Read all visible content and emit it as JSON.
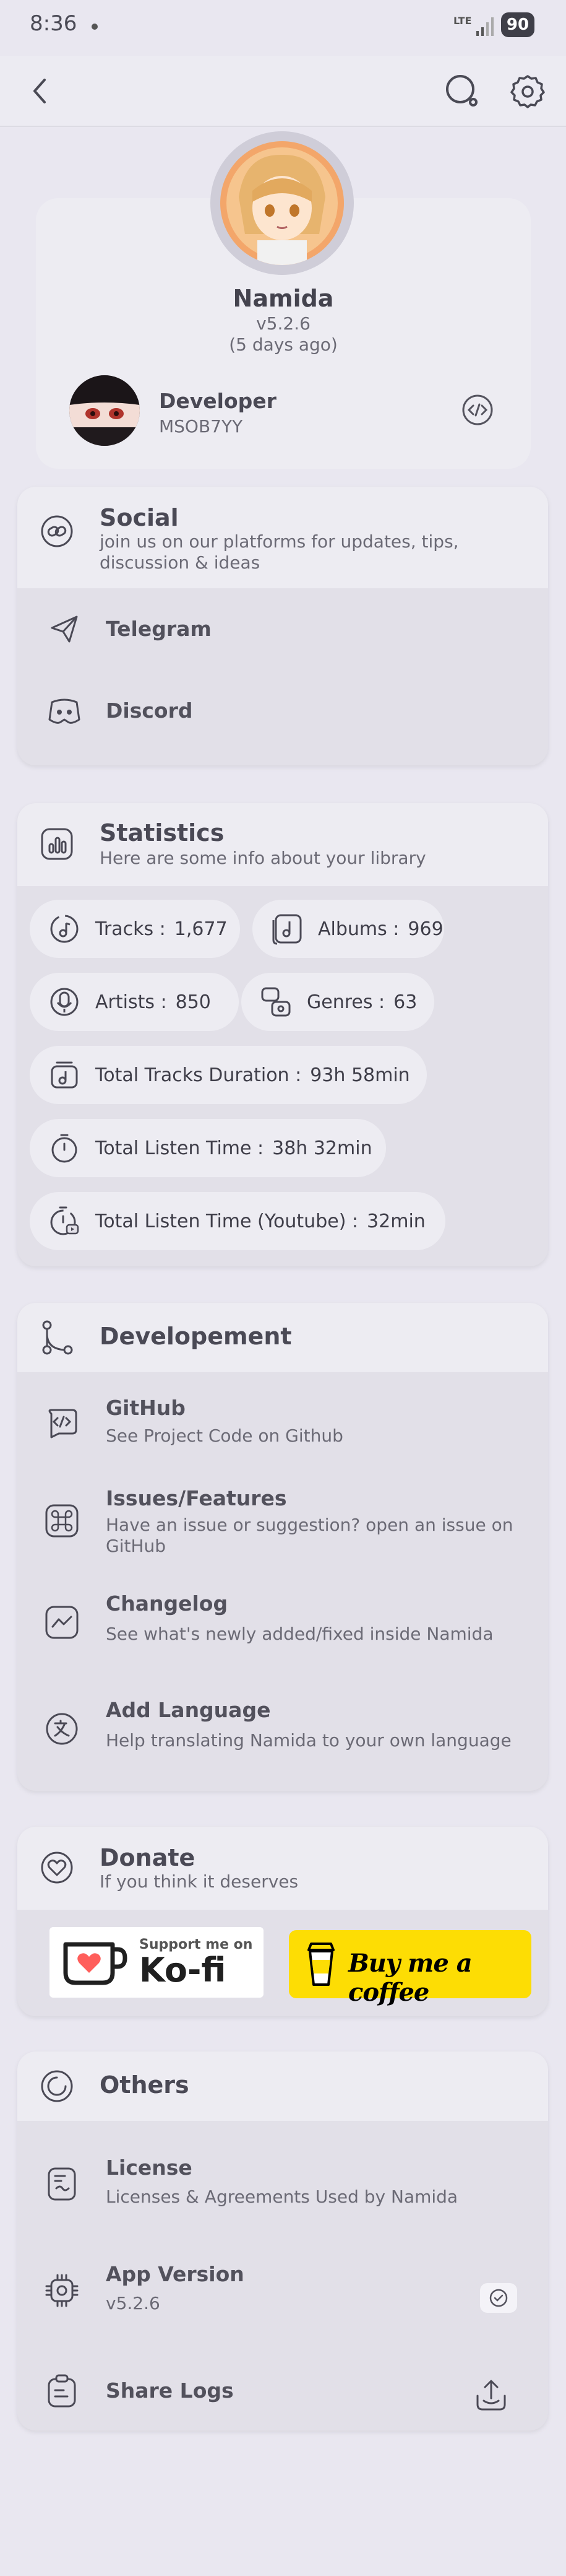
{
  "status_bar": {
    "time": "8:36",
    "network": "LTE",
    "battery": "90"
  },
  "profile": {
    "name": "Namida",
    "version": "v5.2.6",
    "updated": "(5 days ago)",
    "developer_role": "Developer",
    "developer_name": "MSOB7YY"
  },
  "social": {
    "title": "Social",
    "subtitle": "join us on our platforms for updates, tips, discussion & ideas",
    "items": [
      {
        "label": "Telegram",
        "icon": "telegram-icon"
      },
      {
        "label": "Discord",
        "icon": "discord-icon"
      }
    ]
  },
  "statistics": {
    "title": "Statistics",
    "subtitle": "Here are some info about your library",
    "tracks_label": "Tracks :",
    "tracks_value": "1,677",
    "albums_label": "Albums :",
    "albums_value": "969",
    "artists_label": "Artists :",
    "artists_value": "850",
    "genres_label": "Genres :",
    "genres_value": "63",
    "duration_label": "Total Tracks Duration :",
    "duration_value": "93h 58min",
    "listen_label": "Total Listen Time :",
    "listen_value": "38h 32min",
    "youtube_label": "Total Listen Time (Youtube) :",
    "youtube_value": "32min"
  },
  "development": {
    "title": "Developement",
    "items": [
      {
        "title": "GitHub",
        "subtitle": "See Project Code on Github"
      },
      {
        "title": "Issues/Features",
        "subtitle": "Have an issue or suggestion? open an issue on GitHub"
      },
      {
        "title": "Changelog",
        "subtitle": "See what's newly added/fixed inside Namida"
      },
      {
        "title": "Add Language",
        "subtitle": "Help translating Namida to your own language"
      }
    ]
  },
  "donate": {
    "title": "Donate",
    "subtitle": "If you think it deserves",
    "kofi_small": "Support me on",
    "kofi_big": "Ko-fi",
    "bmc": "Buy me a coffee"
  },
  "others": {
    "title": "Others",
    "items": [
      {
        "title": "License",
        "subtitle": "Licenses & Agreements Used by Namida"
      },
      {
        "title": "App Version",
        "subtitle": "v5.2.6"
      },
      {
        "title": "Share Logs",
        "subtitle": ""
      }
    ]
  },
  "colors": {
    "background": "#e9e7f0",
    "card": "#e2e0e8",
    "header": "#edecf2",
    "bmc_yellow": "#fddd04",
    "kofi_red": "#ff5e5b"
  }
}
